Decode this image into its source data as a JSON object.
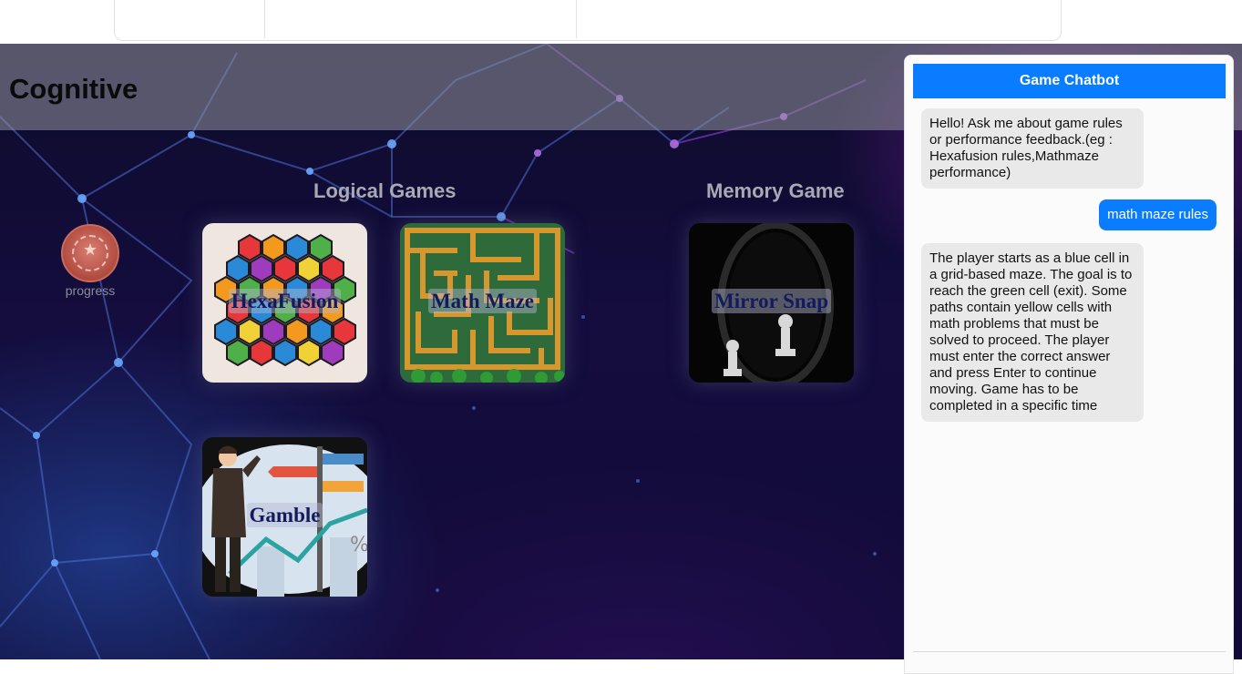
{
  "app": {
    "title": "Cognitive"
  },
  "progress": {
    "label": "progress",
    "icon": "badge-icon"
  },
  "sections": {
    "logical": "Logical Games",
    "memory": "Memory Game"
  },
  "games": {
    "hexafusion": "HexaFusion",
    "mathmaze": "Math Maze",
    "mirrorsnap": "Mirror Snap",
    "gamble": "Gamble"
  },
  "chat": {
    "title": "Game Chatbot",
    "messages": [
      {
        "role": "bot",
        "text": "Hello! Ask me about game rules or performance feedback.(eg : Hexafusion rules,Mathmaze performance)"
      },
      {
        "role": "user",
        "text": "math maze rules"
      },
      {
        "role": "bot",
        "text": "The player starts as a blue cell in a grid-based maze. The goal is to reach the green cell (exit). Some paths contain yellow cells with math problems that must be solved to proceed. The player must enter the correct answer and press Enter to continue moving. Game has to be completed in a specific time"
      }
    ]
  },
  "colors": {
    "accent": "#0a7cff",
    "bot_bubble": "#e9e9e9",
    "background_dark": "#120c3a"
  }
}
